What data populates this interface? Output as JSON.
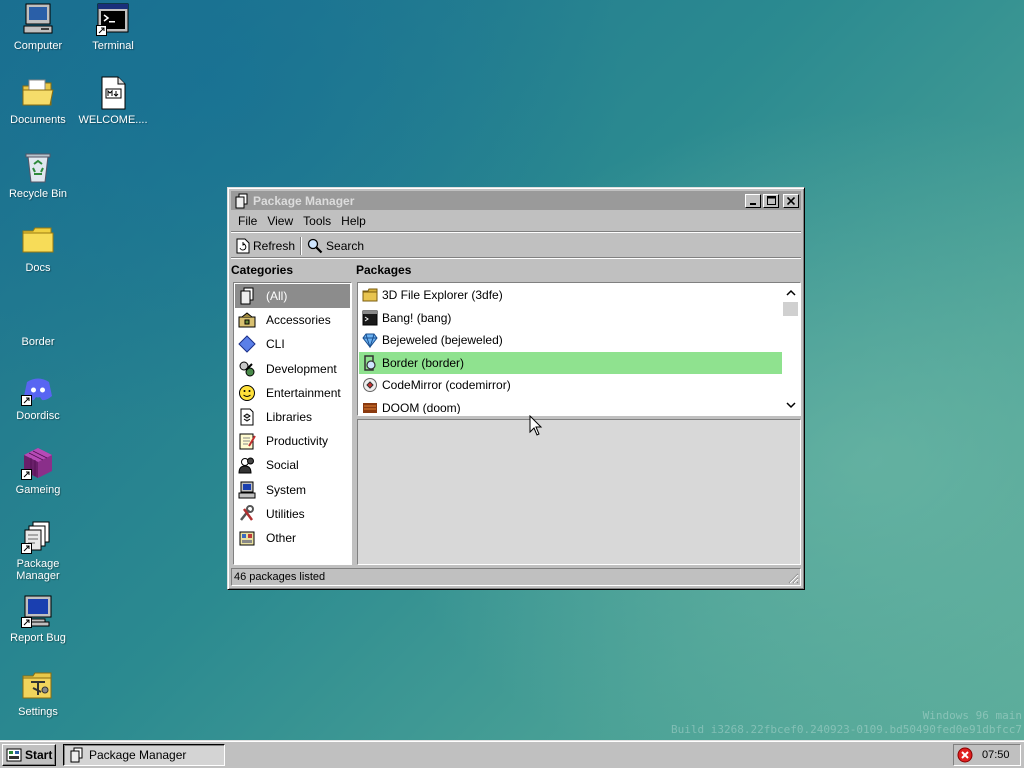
{
  "desktop": {
    "icons": [
      {
        "label": "Computer",
        "icon": "computer-icon"
      },
      {
        "label": "Terminal",
        "icon": "terminal-icon"
      },
      {
        "label": "Documents",
        "icon": "documents-folder-icon"
      },
      {
        "label": "WELCOME....",
        "icon": "markdown-file-icon"
      },
      {
        "label": "Recycle Bin",
        "icon": "recycle-bin-icon"
      },
      {
        "label": "Docs",
        "icon": "folder-icon"
      },
      {
        "label": "Border",
        "icon": ""
      },
      {
        "label": "Doordisc",
        "icon": "discord-icon"
      },
      {
        "label": "Gameing",
        "icon": "game-cube-icon"
      },
      {
        "label": "Package Manager",
        "icon": "package-manager-icon"
      },
      {
        "label": "Report Bug",
        "icon": "monitor-icon"
      },
      {
        "label": "Settings",
        "icon": "settings-icon"
      }
    ]
  },
  "window": {
    "title": "Package Manager",
    "menu": [
      "File",
      "View",
      "Tools",
      "Help"
    ],
    "toolbar": {
      "refresh": "Refresh",
      "search": "Search"
    },
    "headers": {
      "categories": "Categories",
      "packages": "Packages"
    },
    "categories": [
      {
        "label": "(All)",
        "icon": "all-icon",
        "selected": true
      },
      {
        "label": "Accessories",
        "icon": "accessories-icon"
      },
      {
        "label": "CLI",
        "icon": "cli-diamond-icon"
      },
      {
        "label": "Development",
        "icon": "development-icon"
      },
      {
        "label": "Entertainment",
        "icon": "smiley-icon"
      },
      {
        "label": "Libraries",
        "icon": "libraries-icon"
      },
      {
        "label": "Productivity",
        "icon": "productivity-icon"
      },
      {
        "label": "Social",
        "icon": "social-icon"
      },
      {
        "label": "System",
        "icon": "system-icon"
      },
      {
        "label": "Utilities",
        "icon": "utilities-icon"
      },
      {
        "label": "Other",
        "icon": "other-icon"
      }
    ],
    "packages": [
      {
        "label": "3D File Explorer (3dfe)",
        "icon": "folder-icon"
      },
      {
        "label": "Bang! (bang)",
        "icon": "terminal-icon"
      },
      {
        "label": "Bejeweled (bejeweled)",
        "icon": "gem-icon"
      },
      {
        "label": "Border (border)",
        "icon": "border-icon",
        "selected": true
      },
      {
        "label": "CodeMirror (codemirror)",
        "icon": "codemirror-icon"
      },
      {
        "label": "DOOM (doom)",
        "icon": "doom-icon"
      }
    ],
    "status": "46 packages listed"
  },
  "watermark": {
    "line1": "Windows 96 main",
    "line2": "Build i3268.22fbcef0.240923-0109.bd50490fed0e91dbfcc7"
  },
  "taskbar": {
    "start": "Start",
    "task": "Package Manager",
    "clock": "07:50"
  },
  "colors": {
    "selected_package": "#8fe28f",
    "selected_category": "#8c8c8c",
    "face": "#c0c0c0"
  }
}
